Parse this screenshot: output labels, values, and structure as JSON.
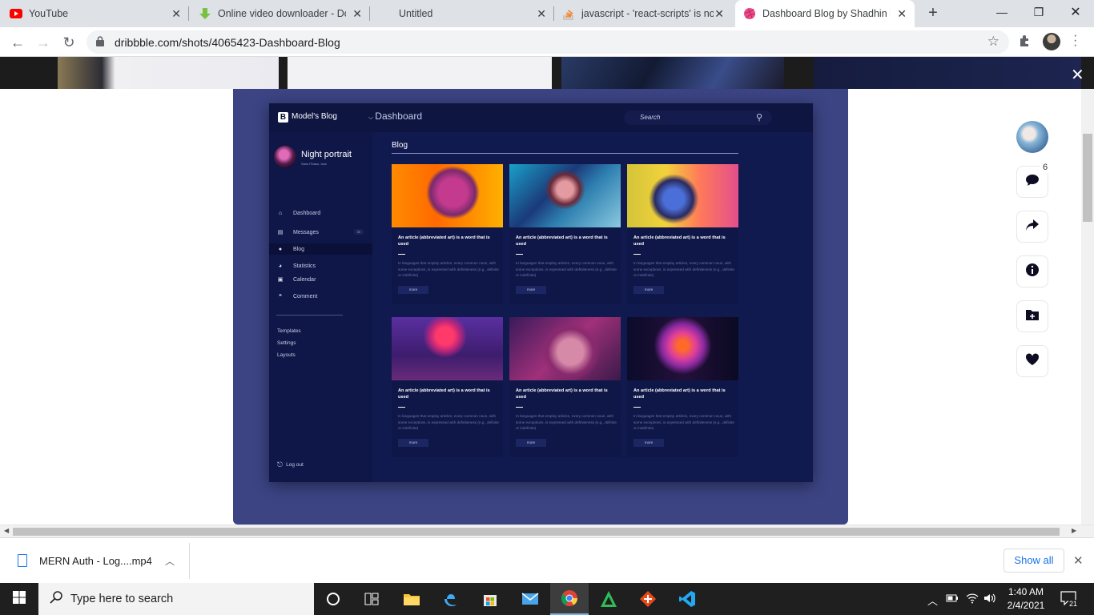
{
  "tabs": [
    {
      "title": "YouTube",
      "icon": "youtube-icon"
    },
    {
      "title": "Online video downloader - Do",
      "icon": "downloader-icon"
    },
    {
      "title": "Untitled",
      "icon": "blank-page-icon"
    },
    {
      "title": "javascript - 'react-scripts' is not",
      "icon": "stackoverflow-icon"
    },
    {
      "title": "Dashboard Blog by Shadhin la",
      "icon": "dribbble-icon"
    }
  ],
  "address_bar": {
    "url": "dribbble.com/shots/4065423-Dashboard-Blog"
  },
  "dashboard": {
    "brand": "Model's Blog",
    "header_title": "Dashboard",
    "search_placeholder": "Search",
    "profile_name": "Night portrait",
    "profile_location": "Sans Finaso, Usa",
    "nav": [
      {
        "label": "Dashboard",
        "icon": "home-icon"
      },
      {
        "label": "Messages",
        "icon": "message-icon",
        "badge": "30"
      },
      {
        "label": "Blog",
        "icon": "user-icon",
        "active": true
      },
      {
        "label": "Statistics",
        "icon": "pie-chart-icon"
      },
      {
        "label": "Calendar",
        "icon": "calendar-icon"
      },
      {
        "label": "Comment",
        "icon": "comment-icon"
      }
    ],
    "secondary_links": [
      "Templates",
      "Settings",
      "Layouts"
    ],
    "logout_label": "Log out",
    "section_title": "Blog",
    "cards": [
      {
        "title": "An article (abbreviated art) is a word that is used",
        "body": "In languages that employ articles, every common noun, with some exceptions, is expressed with definiteness (e.g., definite or indefinite)",
        "button": "more"
      },
      {
        "title": "An article (abbreviated art) is a word that is used",
        "body": "In languages that employ articles, every common noun, with some exceptions, is expressed with definiteness (e.g., definite or indefinite)",
        "button": "more"
      },
      {
        "title": "An article (abbreviated art) is a word that is used",
        "body": "In languages that employ articles, every common noun, with some exceptions, is expressed with definiteness (e.g., definite or indefinite)",
        "button": "more"
      },
      {
        "title": "An article (abbreviated art) is a word that is used",
        "body": "In languages that employ articles, every common noun, with some exceptions, is expressed with definiteness (e.g., definite or indefinite)",
        "button": "more"
      },
      {
        "title": "An article (abbreviated art) is a word that is used",
        "body": "In languages that employ articles, every common noun, with some exceptions, is expressed with definiteness (e.g., definite or indefinite)",
        "button": "more"
      },
      {
        "title": "An article (abbreviated art) is a word that is used",
        "body": "In languages that employ articles, every common noun, with some exceptions, is expressed with definiteness (e.g., definite or indefinite)",
        "button": "more"
      }
    ]
  },
  "actions": {
    "comment_count": "6"
  },
  "download_bar": {
    "file_name": "MERN Auth - Log....mp4",
    "show_all": "Show all"
  },
  "taskbar": {
    "search_placeholder": "Type here to search",
    "time": "1:40 AM",
    "date": "2/4/2021",
    "notification_count": "21"
  },
  "colors": {
    "accent": "#ea4c89",
    "dashboard_bg": "#111a4f",
    "shot_bg": "#3c4484",
    "button_blue": "#1a73e8"
  }
}
